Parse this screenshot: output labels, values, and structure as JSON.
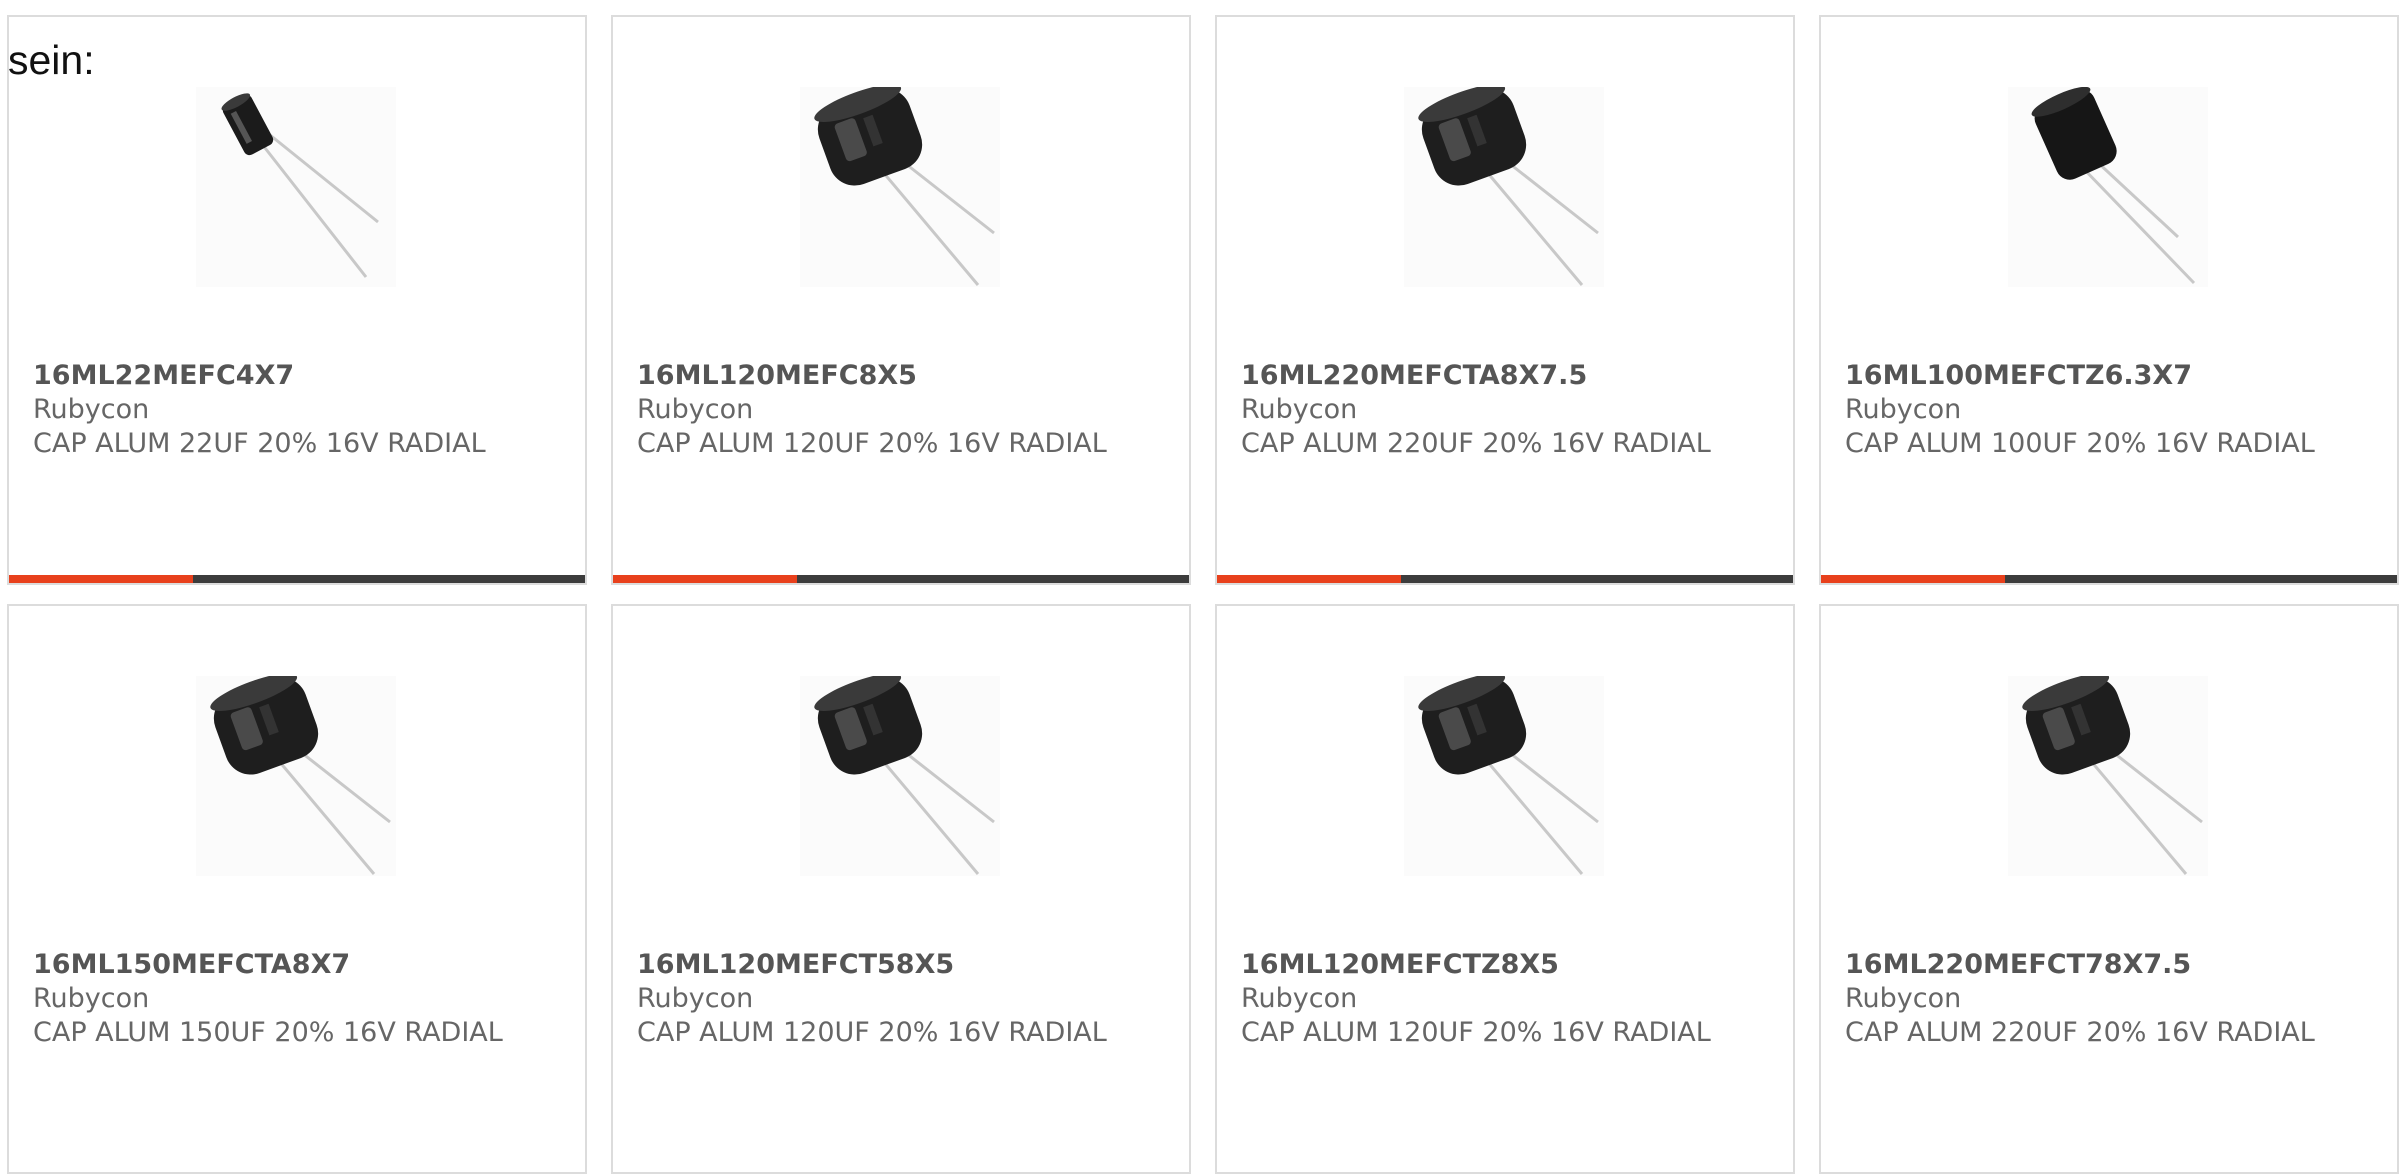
{
  "intro_text": "sein:",
  "accent_color": "#e8401c",
  "bar_color": "#3c3c3c",
  "products": [
    {
      "part_number": "16ML22MEFC4X7",
      "manufacturer": "Rubycon",
      "description": "CAP ALUM 22UF 20% 16V RADIAL",
      "image_icon": "small-capacitor"
    },
    {
      "part_number": "16ML120MEFC8X5",
      "manufacturer": "Rubycon",
      "description": "CAP ALUM 120UF 20% 16V RADIAL",
      "image_icon": "wide-capacitor"
    },
    {
      "part_number": "16ML220MEFCTA8X7.5",
      "manufacturer": "Rubycon",
      "description": "CAP ALUM 220UF 20% 16V RADIAL",
      "image_icon": "wide-capacitor"
    },
    {
      "part_number": "16ML100MEFCTZ6.3X7",
      "manufacturer": "Rubycon",
      "description": "CAP ALUM 100UF 20% 16V RADIAL",
      "image_icon": "plain-capacitor"
    },
    {
      "part_number": "16ML150MEFCTA8X7",
      "manufacturer": "Rubycon",
      "description": "CAP ALUM 150UF 20% 16V RADIAL",
      "image_icon": "wide-capacitor"
    },
    {
      "part_number": "16ML120MEFCT58X5",
      "manufacturer": "Rubycon",
      "description": "CAP ALUM 120UF 20% 16V RADIAL",
      "image_icon": "wide-capacitor"
    },
    {
      "part_number": "16ML120MEFCTZ8X5",
      "manufacturer": "Rubycon",
      "description": "CAP ALUM 120UF 20% 16V RADIAL",
      "image_icon": "wide-capacitor"
    },
    {
      "part_number": "16ML220MEFCT78X7.5",
      "manufacturer": "Rubycon",
      "description": "CAP ALUM 220UF 20% 16V RADIAL",
      "image_icon": "wide-capacitor"
    }
  ]
}
